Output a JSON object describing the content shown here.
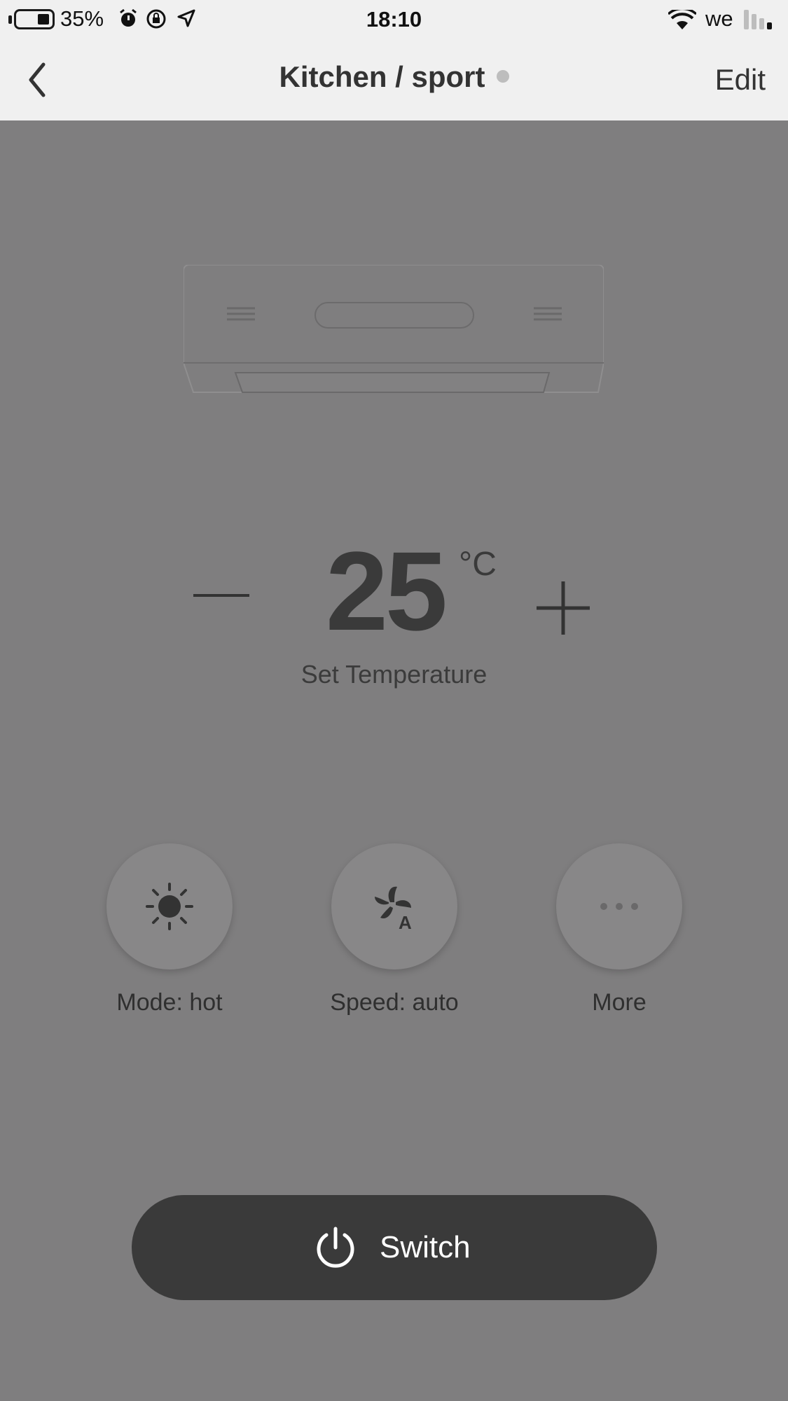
{
  "status_bar": {
    "battery_percent": "35%",
    "time": "18:10",
    "carrier": "we",
    "icons": [
      "battery-icon",
      "alarm-icon",
      "orientation-lock-icon",
      "location-icon",
      "wifi-icon",
      "signal-icon"
    ]
  },
  "nav": {
    "title": "Kitchen / sport",
    "edit_label": "Edit",
    "back_icon": "chevron-left-icon"
  },
  "thermostat": {
    "temperature": "25",
    "unit": "°C",
    "label": "Set Temperature"
  },
  "controls": [
    {
      "label": "Mode: hot",
      "icon": "sun-icon"
    },
    {
      "label": "Speed: auto",
      "icon": "fan-auto-icon"
    },
    {
      "label": "More",
      "icon": "more-icon"
    }
  ],
  "switch": {
    "label": "Switch",
    "icon": "power-icon"
  },
  "colors": {
    "background": "#7f7e7f",
    "bar": "#f0f0f0",
    "switch_bg": "#3a3a3a",
    "status_dot": "#bdbdbd"
  }
}
